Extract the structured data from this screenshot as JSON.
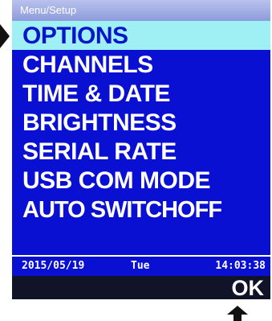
{
  "screen": {
    "title": "Menu/Setup",
    "menu_items": [
      {
        "label": "OPTIONS",
        "selected": true
      },
      {
        "label": "CHANNELS",
        "selected": false
      },
      {
        "label": "TIME & DATE",
        "selected": false
      },
      {
        "label": "BRIGHTNESS",
        "selected": false
      },
      {
        "label": "SERIAL RATE",
        "selected": false
      },
      {
        "label": "USB COM MODE",
        "selected": false
      },
      {
        "label": "AUTO SWITCHOFF",
        "selected": false
      }
    ],
    "status": {
      "date": "2015/05/19",
      "day": "Tue",
      "time": "14:03:38"
    },
    "softkey_right": "OK"
  },
  "colors": {
    "screen_bg": "#0a10d2",
    "selected_bg": "#9ff0f4",
    "selected_text": "#0814c9",
    "softkey_bar": "#111428"
  },
  "icons": {
    "left_pointer": "arrow-right-icon",
    "bottom_pointer": "arrow-up-icon"
  }
}
